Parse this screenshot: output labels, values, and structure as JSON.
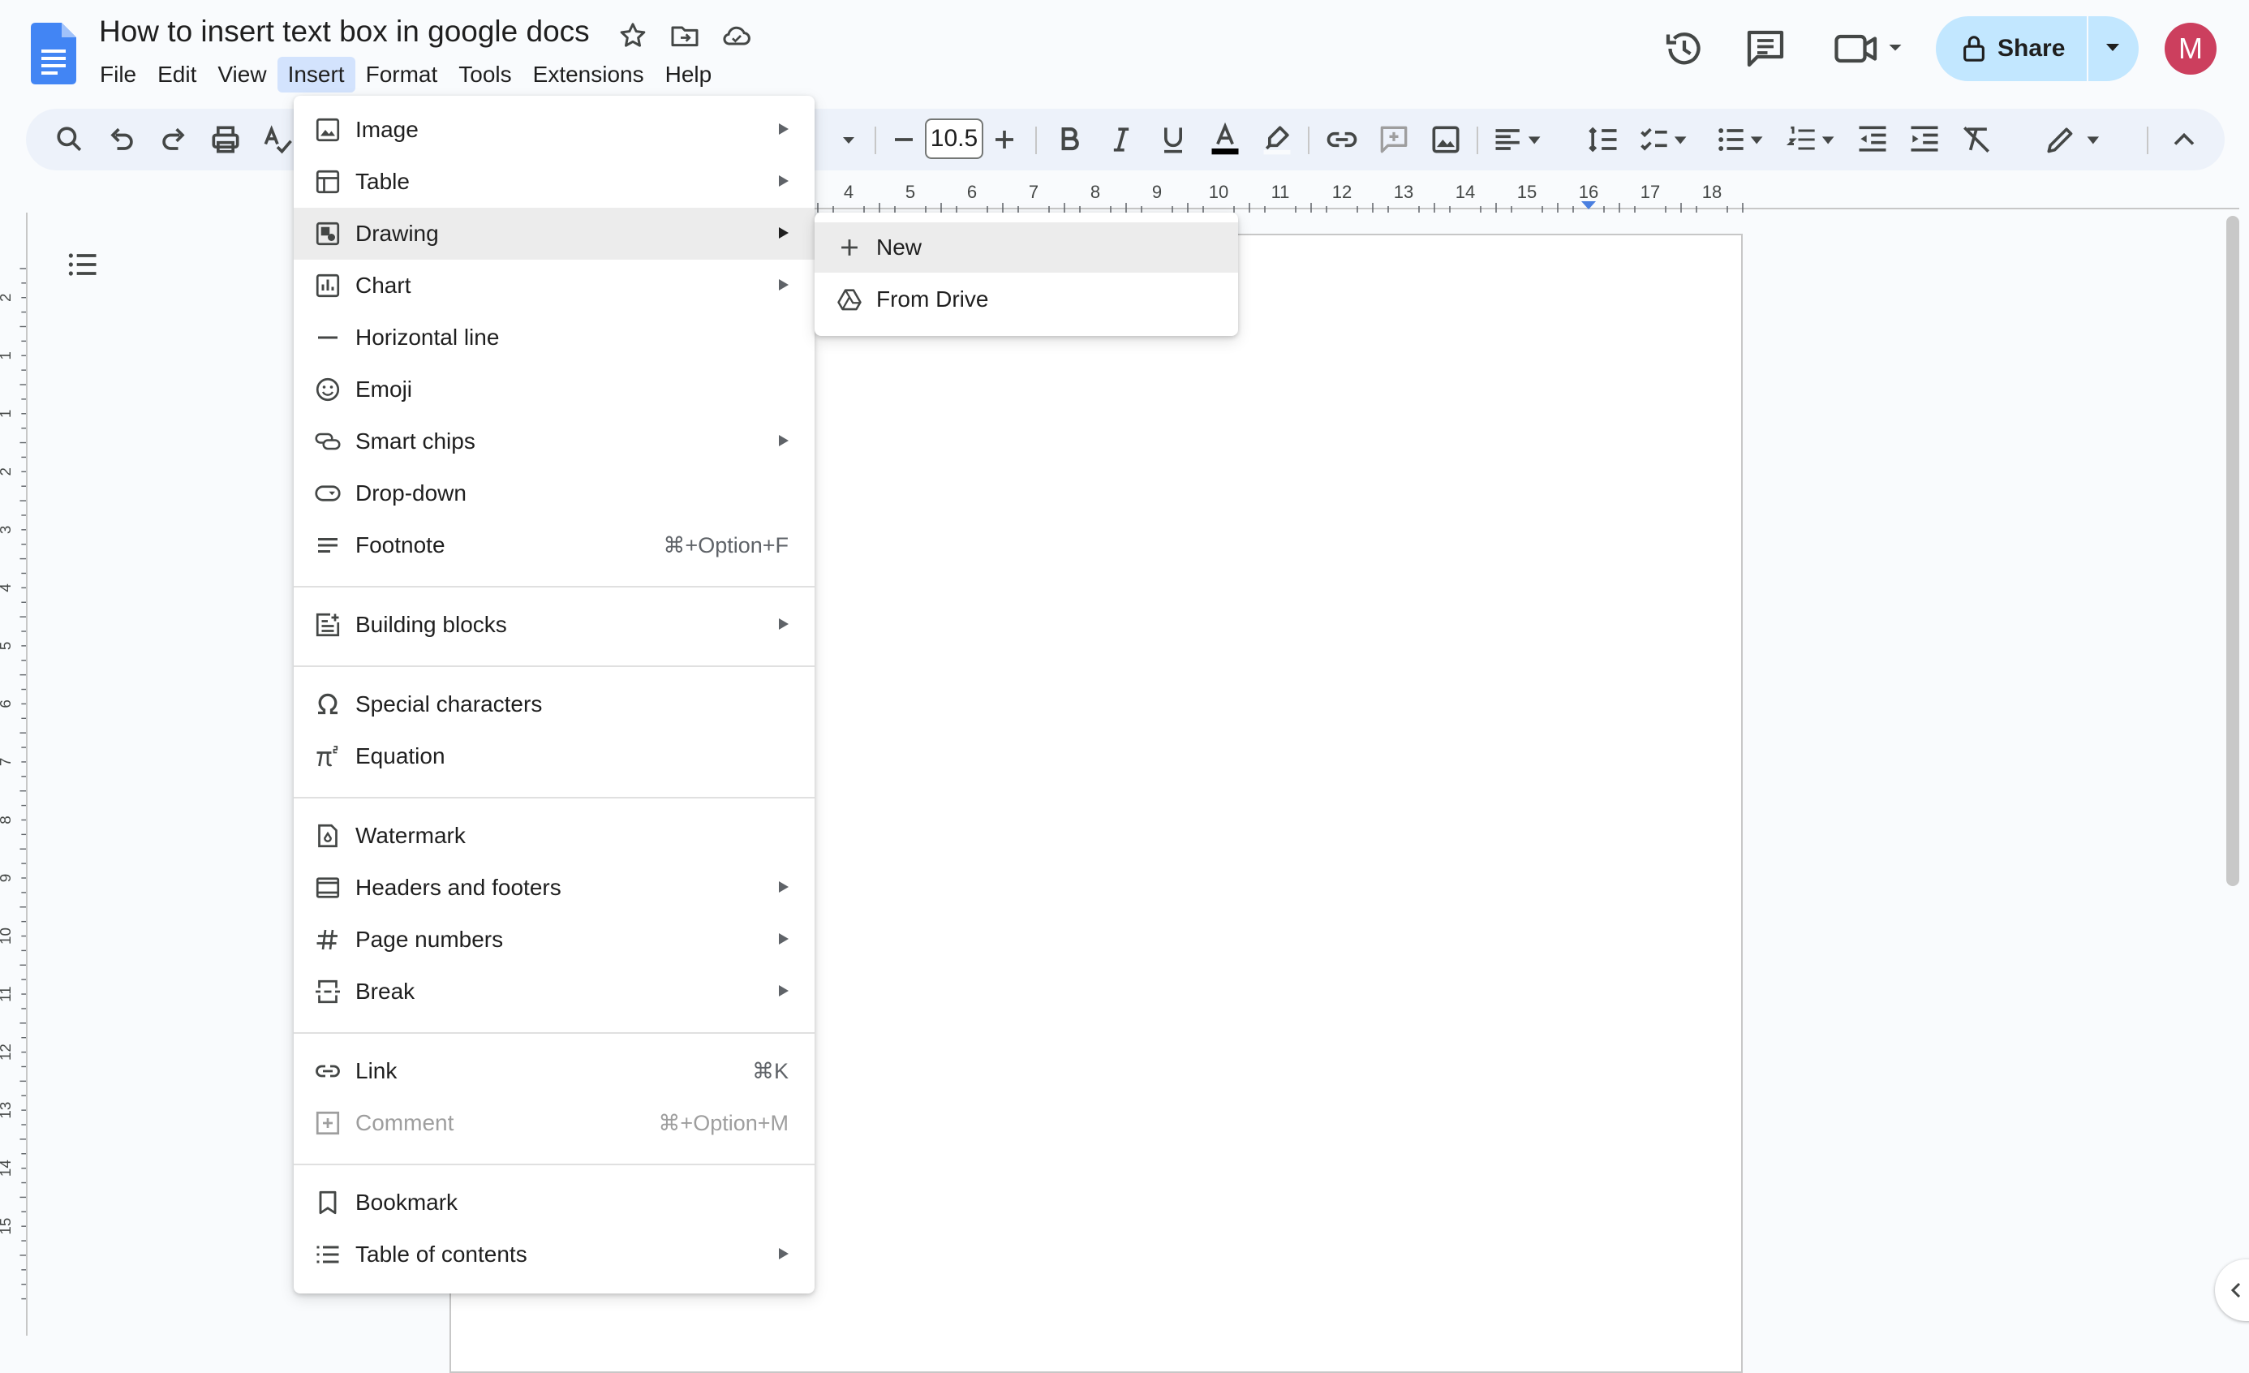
{
  "document": {
    "title": "How to insert text box in google docs"
  },
  "menubar": [
    "File",
    "Edit",
    "View",
    "Insert",
    "Format",
    "Tools",
    "Extensions",
    "Help"
  ],
  "menubar_active": "Insert",
  "header": {
    "share_label": "Share",
    "avatar_initial": "M"
  },
  "toolbar": {
    "font_size": "10.5"
  },
  "ruler": {
    "ticks": [
      "4",
      "5",
      "6",
      "7",
      "8",
      "9",
      "10",
      "11",
      "12",
      "13",
      "14",
      "15",
      "16",
      "17",
      "18"
    ]
  },
  "vertical_ruler": {
    "ticks": [
      "2",
      "1",
      "1",
      "2",
      "3",
      "4",
      "5",
      "6",
      "7",
      "8",
      "9",
      "10",
      "11",
      "12",
      "13",
      "14",
      "15"
    ]
  },
  "insert_menu": {
    "items": [
      {
        "label": "Image",
        "icon": "image-icon",
        "submenu": true
      },
      {
        "label": "Table",
        "icon": "table-icon",
        "submenu": true
      },
      {
        "label": "Drawing",
        "icon": "drawing-icon",
        "submenu": true,
        "highlighted": true
      },
      {
        "label": "Chart",
        "icon": "chart-icon",
        "submenu": true
      },
      {
        "label": "Horizontal line",
        "icon": "horizontal-line-icon"
      },
      {
        "label": "Emoji",
        "icon": "emoji-icon"
      },
      {
        "label": "Smart chips",
        "icon": "smart-chips-icon",
        "submenu": true
      },
      {
        "label": "Drop-down",
        "icon": "dropdown-icon"
      },
      {
        "label": "Footnote",
        "icon": "footnote-icon",
        "shortcut": "⌘+Option+F"
      },
      {
        "label": "Building blocks",
        "icon": "building-blocks-icon",
        "submenu": true
      },
      {
        "label": "Special characters",
        "icon": "omega-icon"
      },
      {
        "label": "Equation",
        "icon": "pi-icon"
      },
      {
        "label": "Watermark",
        "icon": "watermark-icon"
      },
      {
        "label": "Headers and footers",
        "icon": "headers-footers-icon",
        "submenu": true
      },
      {
        "label": "Page numbers",
        "icon": "hash-icon",
        "submenu": true
      },
      {
        "label": "Break",
        "icon": "break-icon",
        "submenu": true
      },
      {
        "label": "Link",
        "icon": "link-icon",
        "shortcut": "⌘K"
      },
      {
        "label": "Comment",
        "icon": "comment-add-icon",
        "shortcut": "⌘+Option+M",
        "disabled": true
      },
      {
        "label": "Bookmark",
        "icon": "bookmark-icon"
      },
      {
        "label": "Table of contents",
        "icon": "toc-icon",
        "submenu": true
      }
    ]
  },
  "drawing_submenu": {
    "items": [
      {
        "label": "New",
        "icon": "plus-icon",
        "highlighted": true
      },
      {
        "label": "From Drive",
        "icon": "drive-icon"
      }
    ]
  },
  "colors": {
    "accent": "#0b57d0",
    "share_bg": "#c2e7ff",
    "avatar_bg": "#cc3f5e",
    "menu_active": "#d3e3fd",
    "toolbar_bg": "#edf2fa"
  }
}
